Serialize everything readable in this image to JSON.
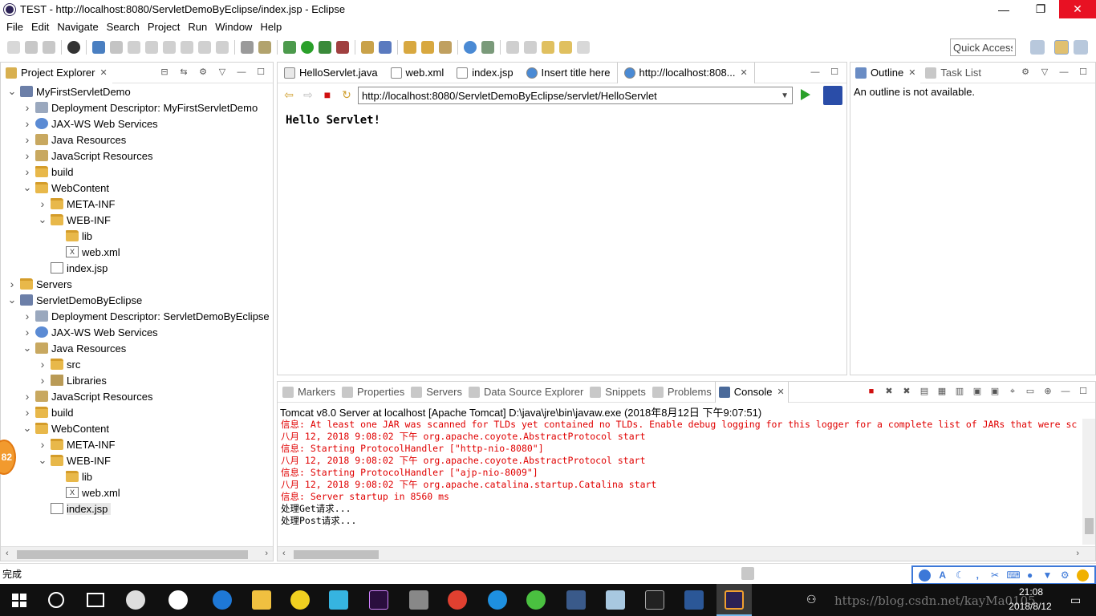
{
  "window": {
    "title": "TEST - http://localhost:8080/ServletDemoByEclipse/index.jsp - Eclipse",
    "minimize": "—",
    "restore": "❐",
    "close": "✕"
  },
  "menu": [
    "File",
    "Edit",
    "Navigate",
    "Search",
    "Project",
    "Run",
    "Window",
    "Help"
  ],
  "toolbar": {
    "quick_access": "Quick Access"
  },
  "project_explorer": {
    "tab_label": "Project Explorer",
    "tree": [
      {
        "label": "MyFirstServletDemo",
        "icon": "project-icon",
        "expanded": true
      },
      {
        "label": "Deployment Descriptor: MyFirstServletDemo",
        "icon": "descriptor-icon",
        "expanded": false
      },
      {
        "label": "JAX-WS Web Services",
        "icon": "webservices-icon",
        "expanded": false
      },
      {
        "label": "Java Resources",
        "icon": "java-resources-icon",
        "expanded": false
      },
      {
        "label": "JavaScript Resources",
        "icon": "js-resources-icon",
        "expanded": false
      },
      {
        "label": "build",
        "icon": "folder-icon",
        "expanded": false
      },
      {
        "label": "WebContent",
        "icon": "folder-icon",
        "expanded": true
      },
      {
        "label": "META-INF",
        "icon": "folder-icon",
        "expanded": false
      },
      {
        "label": "WEB-INF",
        "icon": "folder-icon",
        "expanded": true
      },
      {
        "label": "lib",
        "icon": "folder-icon",
        "expanded": null
      },
      {
        "label": "web.xml",
        "icon": "xml-file-icon",
        "expanded": null
      },
      {
        "label": "index.jsp",
        "icon": "jsp-file-icon",
        "expanded": null
      },
      {
        "label": "Servers",
        "icon": "folder-icon",
        "expanded": false
      },
      {
        "label": "ServletDemoByEclipse",
        "icon": "project-icon",
        "expanded": true
      },
      {
        "label": "Deployment Descriptor: ServletDemoByEclipse",
        "icon": "descriptor-icon",
        "expanded": false
      },
      {
        "label": "JAX-WS Web Services",
        "icon": "webservices-icon",
        "expanded": false
      },
      {
        "label": "Java Resources",
        "icon": "java-resources-icon",
        "expanded": true
      },
      {
        "label": "src",
        "icon": "package-icon",
        "expanded": false
      },
      {
        "label": "Libraries",
        "icon": "library-icon",
        "expanded": false
      },
      {
        "label": "JavaScript Resources",
        "icon": "js-resources-icon",
        "expanded": false
      },
      {
        "label": "build",
        "icon": "folder-icon",
        "expanded": false
      },
      {
        "label": "WebContent",
        "icon": "folder-icon",
        "expanded": true
      },
      {
        "label": "META-INF",
        "icon": "folder-icon",
        "expanded": false
      },
      {
        "label": "WEB-INF",
        "icon": "folder-icon",
        "expanded": true
      },
      {
        "label": "lib",
        "icon": "folder-icon",
        "expanded": null
      },
      {
        "label": "web.xml",
        "icon": "xml-file-icon",
        "expanded": null
      },
      {
        "label": "index.jsp",
        "icon": "jsp-file-icon",
        "expanded": null,
        "selected": true
      }
    ]
  },
  "editor": {
    "tabs": [
      {
        "label": "HelloServlet.java",
        "icon": "java-file-icon"
      },
      {
        "label": "web.xml",
        "icon": "xml-file-icon"
      },
      {
        "label": "index.jsp",
        "icon": "jsp-file-icon"
      },
      {
        "label": "Insert title here",
        "icon": "globe-icon"
      },
      {
        "label": "http://localhost:808...",
        "icon": "globe-icon",
        "active": true
      }
    ],
    "url": "http://localhost:8080/ServletDemoByEclipse/servlet/HelloServlet",
    "page_text": "Hello Servlet!"
  },
  "outline": {
    "tabs": [
      {
        "label": "Outline",
        "active": true
      },
      {
        "label": "Task List"
      }
    ],
    "message": "An outline is not available."
  },
  "bottom_panel": {
    "tabs": [
      {
        "label": "Markers"
      },
      {
        "label": "Properties"
      },
      {
        "label": "Servers"
      },
      {
        "label": "Data Source Explorer"
      },
      {
        "label": "Snippets"
      },
      {
        "label": "Problems"
      },
      {
        "label": "Console",
        "active": true
      }
    ],
    "console_title": "Tomcat v8.0 Server at localhost [Apache Tomcat] D:\\java\\jre\\bin\\javaw.exe (2018年8月12日 下午9:07:51)",
    "lines": [
      {
        "text": "信息: At least one JAR was scanned for TLDs yet contained no TLDs. Enable debug logging for this logger for a complete list of JARs that were sc",
        "color": "#e00000"
      },
      {
        "text": "八月 12, 2018 9:08:02 下午 org.apache.coyote.AbstractProtocol start",
        "color": "#e00000"
      },
      {
        "text": "信息: Starting ProtocolHandler [\"http-nio-8080\"]",
        "color": "#e00000"
      },
      {
        "text": "八月 12, 2018 9:08:02 下午 org.apache.coyote.AbstractProtocol start",
        "color": "#e00000"
      },
      {
        "text": "信息: Starting ProtocolHandler [\"ajp-nio-8009\"]",
        "color": "#e00000"
      },
      {
        "text": "八月 12, 2018 9:08:02 下午 org.apache.catalina.startup.Catalina start",
        "color": "#e00000"
      },
      {
        "text": "信息: Server startup in 8560 ms",
        "color": "#e00000"
      },
      {
        "text": "处理Get请求...",
        "color": "#000000"
      },
      {
        "text": "处理Post请求...",
        "color": "#000000"
      }
    ]
  },
  "status": {
    "text": "完成",
    "ime_label": "A"
  },
  "floating_badge": "82",
  "taskbar": {
    "time": "21:08",
    "date": "2018/8/12",
    "watermark": "https://blog.csdn.net/kayMa0105"
  }
}
